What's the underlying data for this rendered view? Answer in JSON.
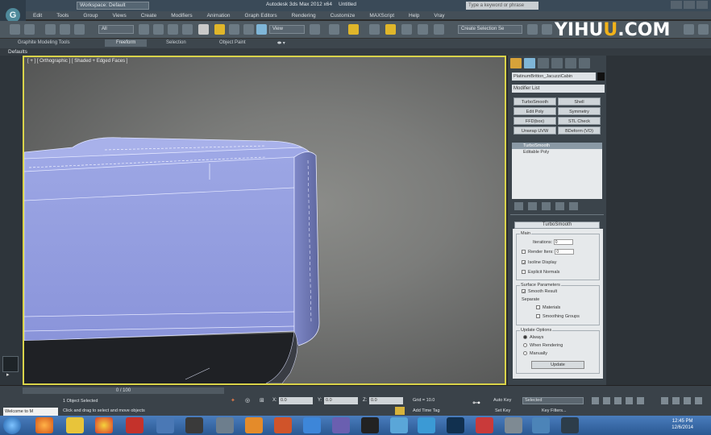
{
  "titlebar": {
    "workspace": "Workspace: Default",
    "app_title": "Autodesk 3ds Max  2012 x64",
    "doc_title": "Untitled",
    "search_placeholder": "Type a keyword or phrase"
  },
  "menu": [
    "Edit",
    "Tools",
    "Group",
    "Views",
    "Create",
    "Modifiers",
    "Animation",
    "Graph Editors",
    "Rendering",
    "Customize",
    "MAXScript",
    "Help",
    "Vray"
  ],
  "toolbar": {
    "filter_value": "All",
    "view_value": "View",
    "selection_set": "Create Selection Se"
  },
  "watermark": {
    "text_a": "YIHU",
    "text_o": "U",
    "text_b": ".COM"
  },
  "ribbon": {
    "tabs": [
      "Graphite Modeling Tools",
      "Freeform",
      "Selection",
      "Object Paint"
    ],
    "active_index": 1,
    "defaults_label": "Defaults"
  },
  "viewport": {
    "label": "[ + ] [ Orthographic ] [ Shaded + Edged Faces ]"
  },
  "command_panel": {
    "object_name": "PlatinumBritton_JacuzziCabin",
    "modifier_list": "Modifier List",
    "modifier_buttons": [
      "TurboSmooth",
      "Shell",
      "Edit Poly",
      "Symmetry",
      "FFD(box)",
      "STL Check",
      "Unwrap UVW",
      "BDeform (VO)"
    ],
    "stack": {
      "selected": "TurboSmooth",
      "base": "Editable Poly"
    },
    "turbosmooth": {
      "title": "TurboSmooth",
      "main_group": "Main",
      "iterations_label": "Iterations:",
      "iterations_value": "0",
      "render_iters_label": "Render Iters:",
      "render_iters_value": "0",
      "isoline": "Isoline Display",
      "explicit": "Explicit Normals",
      "surface_group": "Surface Parameters",
      "smooth_result": "Smooth Result",
      "separate": "Separate",
      "materials": "Materials",
      "smoothing_groups": "Smoothing Groups",
      "update_group": "Update Options",
      "always": "Always",
      "when_rendering": "When Rendering",
      "manually": "Manually",
      "update_button": "Update"
    }
  },
  "status": {
    "time_slider": "0 / 100",
    "welcome": "Welcome to M",
    "selected": "1 Object Selected",
    "prompt": "Click and drag to select and move objects",
    "x_label": "X:",
    "x_value": "0.0",
    "y_label": "Y:",
    "y_value": "0.0",
    "z_label": "Z:",
    "z_value": "0.0",
    "grid": "Grid = 10.0",
    "add_time_tag": "Add Time Tag",
    "auto_key": "Auto Key",
    "set_key": "Set Key",
    "selected_dd": "Selected",
    "key_filters": "Key Filters..."
  },
  "taskbar": {
    "time": "12:45 PM",
    "date": "12/6/2014"
  }
}
